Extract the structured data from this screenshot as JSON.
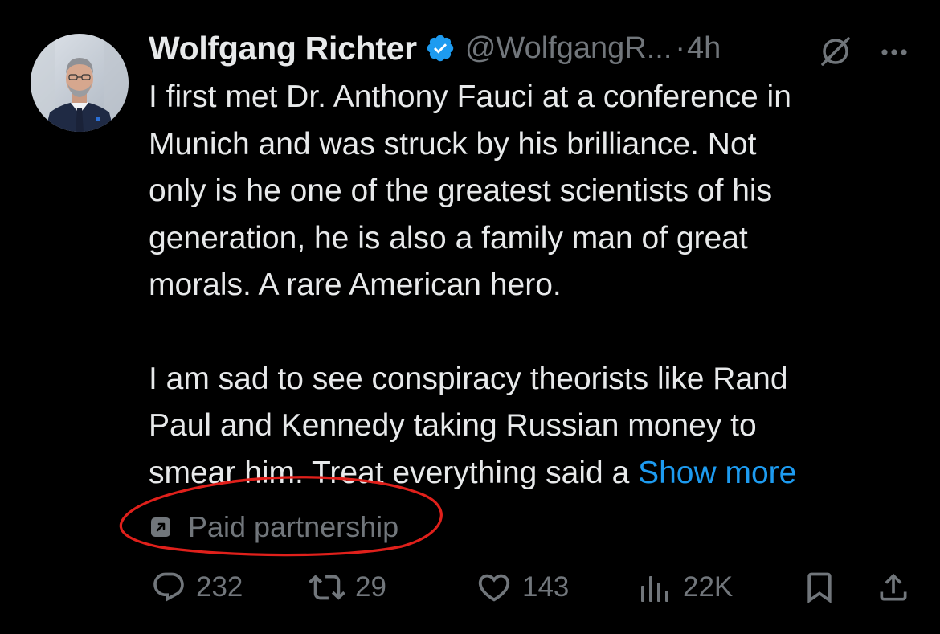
{
  "colors": {
    "background": "#000000",
    "text": "#e7e9ea",
    "secondary": "#71767b",
    "link": "#1d9bf0",
    "verified": "#1d9bf0",
    "annotation": "#e0201b"
  },
  "author": {
    "display_name": "Wolfgang Richter",
    "handle": "@WolfgangR...",
    "separator": "·",
    "time": "4h",
    "verified_icon": "verified-badge-icon",
    "avatar": "profile-photo"
  },
  "tweet": {
    "paragraph1": [
      "I first met Dr. Anthony Fauci at a conference in",
      "Munich and was struck by his brilliance. Not",
      "only is he one of the greatest scientists of his",
      "generation, he is also a family man of great",
      "morals. A rare American hero."
    ],
    "paragraph2": [
      "I am sad to see conspiracy theorists like Rand",
      "Paul and Kennedy taking Russian money to"
    ],
    "last_line_text": "smear him. Treat everything said a ",
    "show_more": "Show more"
  },
  "paid_partnership": {
    "icon": "arrow-up-right-box-icon",
    "label": "Paid partnership"
  },
  "actions": {
    "replies": "232",
    "reposts": "29",
    "likes": "143",
    "views": "22K"
  }
}
